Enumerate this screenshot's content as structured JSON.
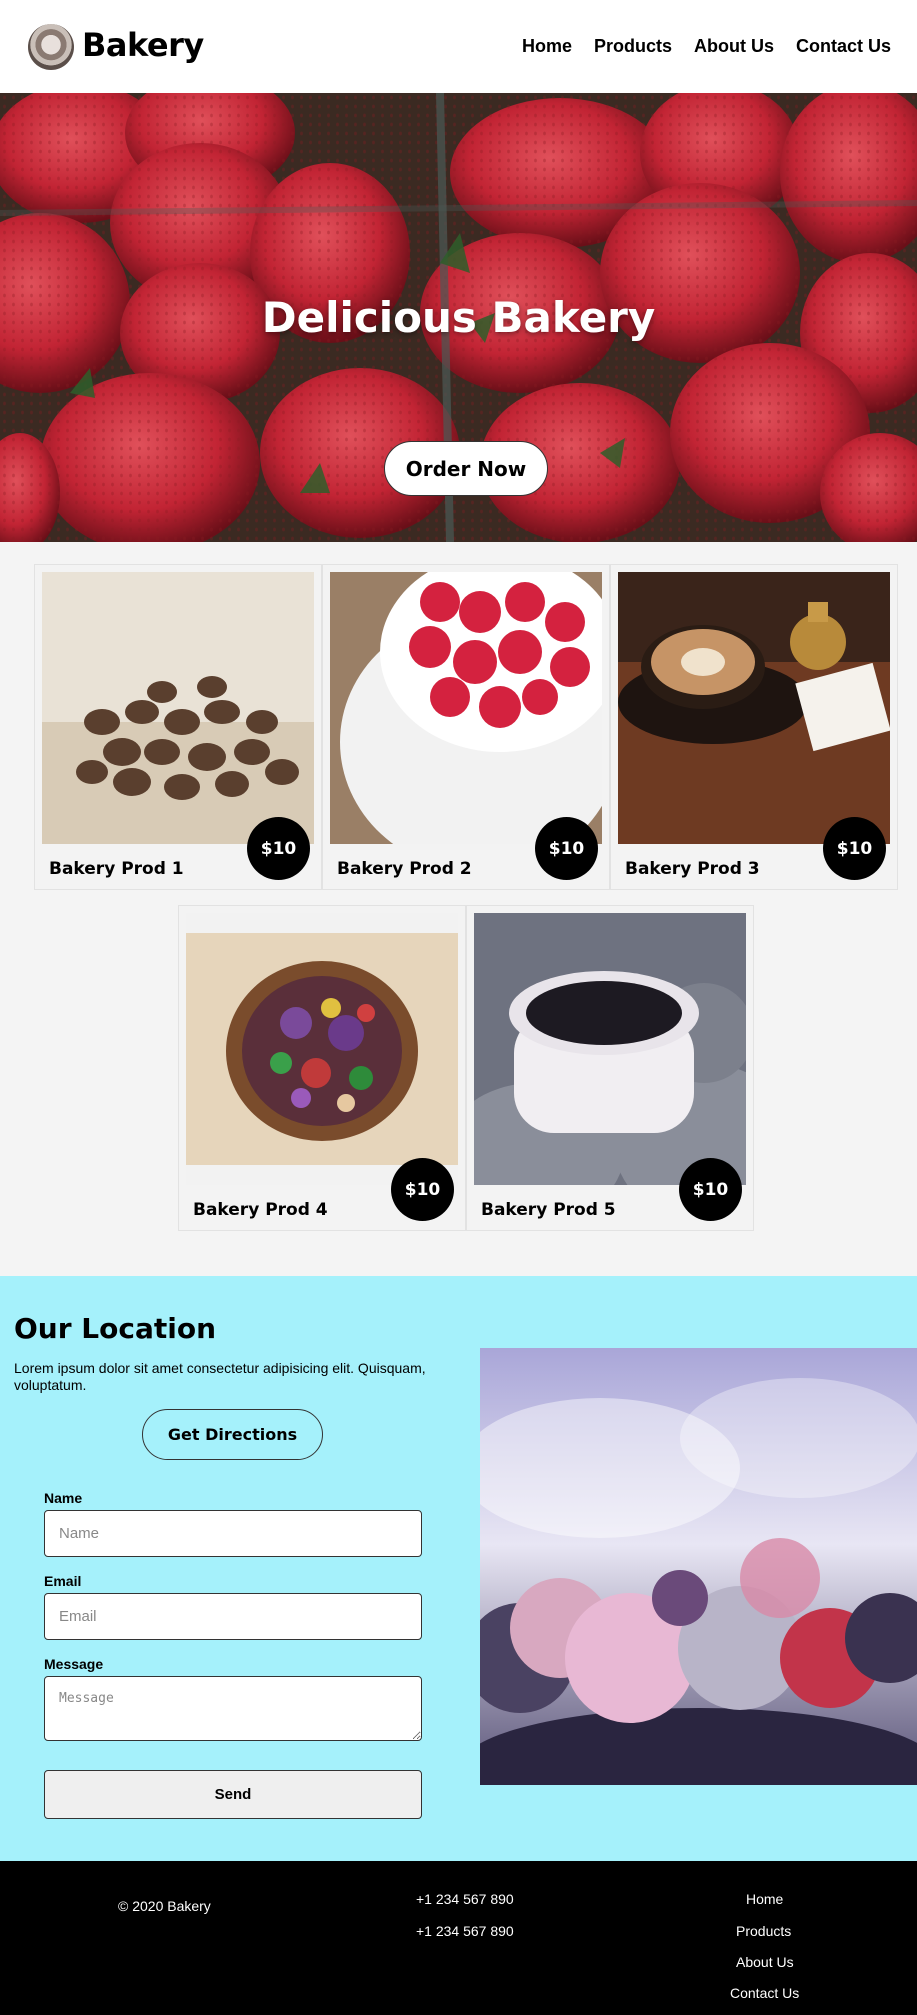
{
  "header": {
    "brand": "Bakery",
    "nav": [
      "Home",
      "Products",
      "About Us",
      "Contact Us"
    ]
  },
  "hero": {
    "title": "Delicious Bakery",
    "button": "Order Now"
  },
  "products": [
    {
      "name": "Bakery Prod 1",
      "price": "$10",
      "image": "coffee-beans"
    },
    {
      "name": "Bakery Prod 2",
      "price": "$10",
      "image": "raspberries-cup"
    },
    {
      "name": "Bakery Prod 3",
      "price": "$10",
      "image": "latte-cup"
    },
    {
      "name": "Bakery Prod 4",
      "price": "$10",
      "image": "salad-bowl"
    },
    {
      "name": "Bakery Prod 5",
      "price": "$10",
      "image": "coffee-mug-knit"
    }
  ],
  "location": {
    "title": "Our Location",
    "text": "Lorem ipsum dolor sit amet consectetur adipisicing elit. Quisquam, voluptatum.",
    "directions_button": "Get Directions",
    "form": {
      "name_label": "Name",
      "name_placeholder": "Name",
      "email_label": "Email",
      "email_placeholder": "Email",
      "message_label": "Message",
      "message_placeholder": "Message",
      "send_button": "Send"
    }
  },
  "footer": {
    "copyright": "© 2020 Bakery",
    "phones": [
      "+1 234 567 890",
      "+1 234 567 890"
    ],
    "links": [
      "Home",
      "Products",
      "About Us",
      "Contact Us"
    ]
  },
  "colors": {
    "location_bg": "#a5f1fb",
    "footer_bg": "#000000",
    "price_badge": "#000000"
  }
}
